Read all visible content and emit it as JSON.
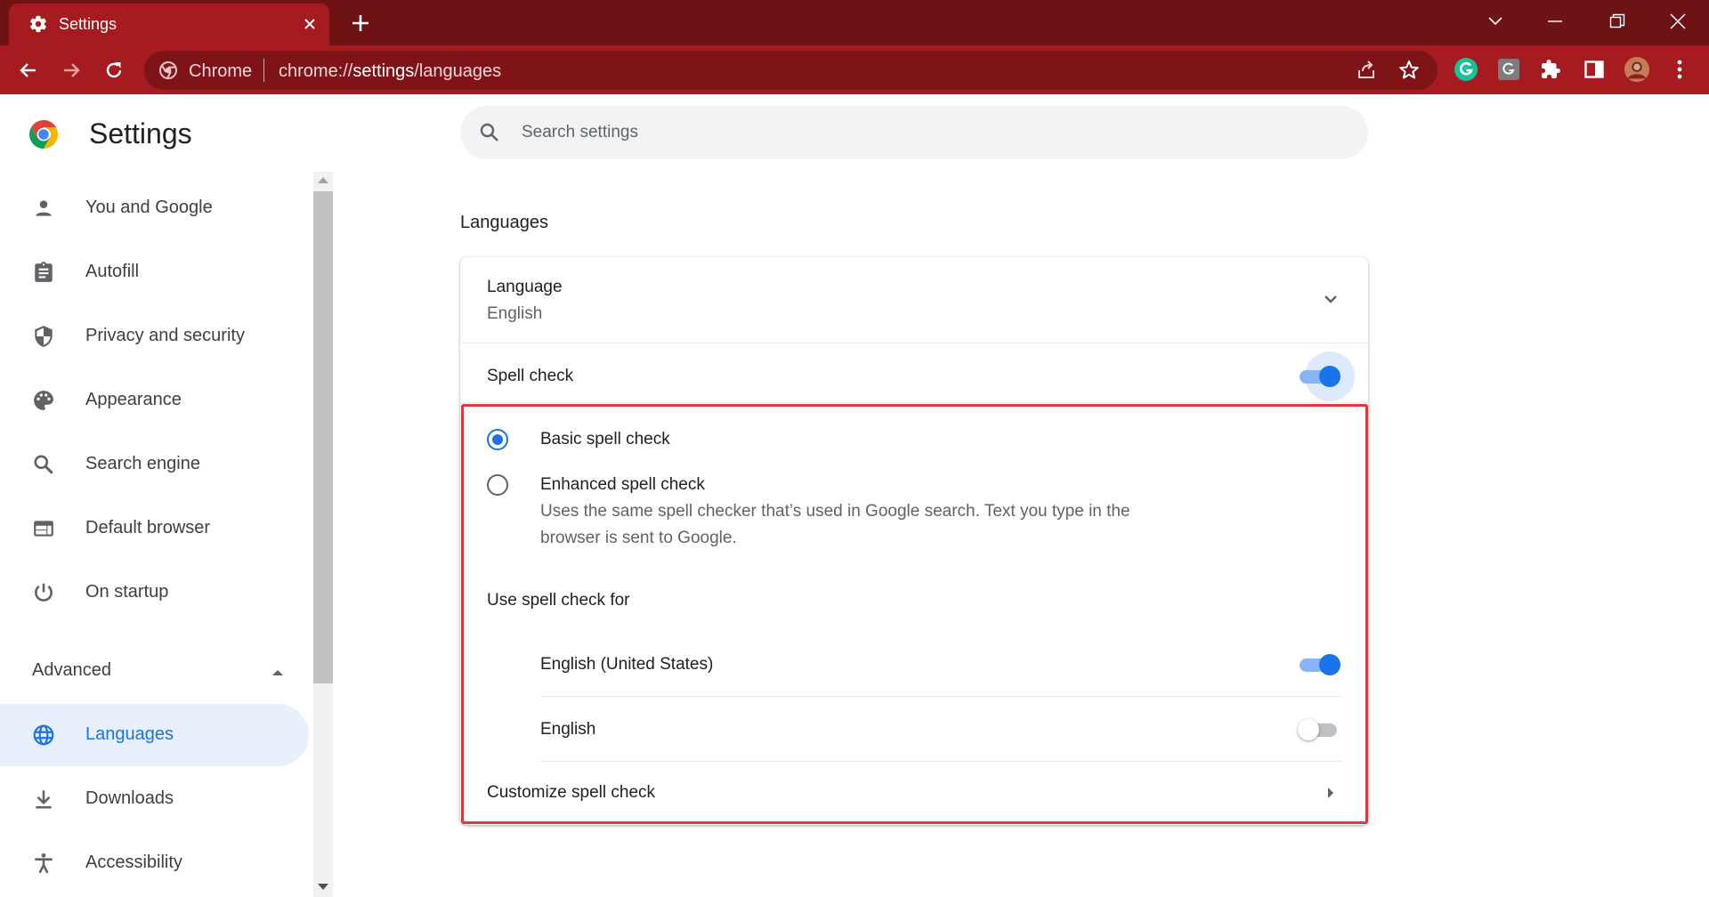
{
  "browser": {
    "tab_title": "Settings",
    "site_name": "Chrome",
    "url_scheme": "chrome://",
    "url_host": "settings",
    "url_path": "/languages"
  },
  "header": {
    "title": "Settings",
    "search_placeholder": "Search settings"
  },
  "sidebar": {
    "items": [
      {
        "label": "You and Google",
        "icon": "person-icon"
      },
      {
        "label": "Autofill",
        "icon": "clipboard-icon"
      },
      {
        "label": "Privacy and security",
        "icon": "shield-icon"
      },
      {
        "label": "Appearance",
        "icon": "palette-icon"
      },
      {
        "label": "Search engine",
        "icon": "search-icon"
      },
      {
        "label": "Default browser",
        "icon": "browser-window-icon"
      },
      {
        "label": "On startup",
        "icon": "power-icon"
      }
    ],
    "advanced_label": "Advanced",
    "advanced_items": [
      {
        "label": "Languages",
        "icon": "globe-icon",
        "active": true
      },
      {
        "label": "Downloads",
        "icon": "download-icon"
      },
      {
        "label": "Accessibility",
        "icon": "accessibility-icon"
      }
    ]
  },
  "main": {
    "section_title": "Languages",
    "language": {
      "label": "Language",
      "value": "English"
    },
    "spell_check": {
      "label": "Spell check",
      "enabled": true
    },
    "options": {
      "basic": {
        "label": "Basic spell check",
        "selected": true
      },
      "enhanced": {
        "label": "Enhanced spell check",
        "description_line1": "Uses the same spell checker that’s used in Google search. Text you type in the",
        "description_line2": "browser is sent to Google.",
        "selected": false
      }
    },
    "use_for": {
      "label": "Use spell check for",
      "languages": [
        {
          "label": "English (United States)",
          "enabled": true
        },
        {
          "label": "English",
          "enabled": false
        }
      ]
    },
    "customize": {
      "label": "Customize spell check"
    }
  },
  "colors": {
    "frame": "#6e1214",
    "toolbar": "#a51b1f",
    "accent": "#1a73e8",
    "highlight_border": "#e2363d"
  }
}
